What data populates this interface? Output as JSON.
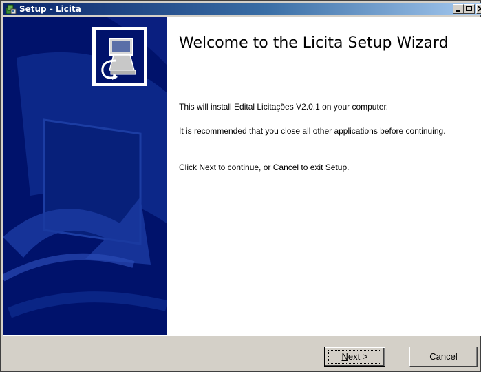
{
  "titlebar": {
    "icon": "setup-wizard-icon",
    "title": "Setup - Licita",
    "buttons": {
      "minimize": "minimize-icon",
      "maximize": "maximize-icon",
      "close": "close-icon"
    }
  },
  "sidebar": {
    "logo": "computer-install-logo"
  },
  "content": {
    "heading": "Welcome to the Licita Setup Wizard",
    "paragraphs": [
      "This will install Edital Licitações V2.0.1 on your computer.",
      "It is recommended that you close all other applications before continuing.",
      "Click Next to continue, or Cancel to exit Setup."
    ]
  },
  "buttons": {
    "next_mnemonic": "N",
    "next_rest": "ext >",
    "cancel": "Cancel"
  },
  "colors": {
    "sidebar": "#00126b",
    "titlebar_start": "#0a246a",
    "titlebar_end": "#a6caf0",
    "dialog": "#d4d0c8"
  }
}
